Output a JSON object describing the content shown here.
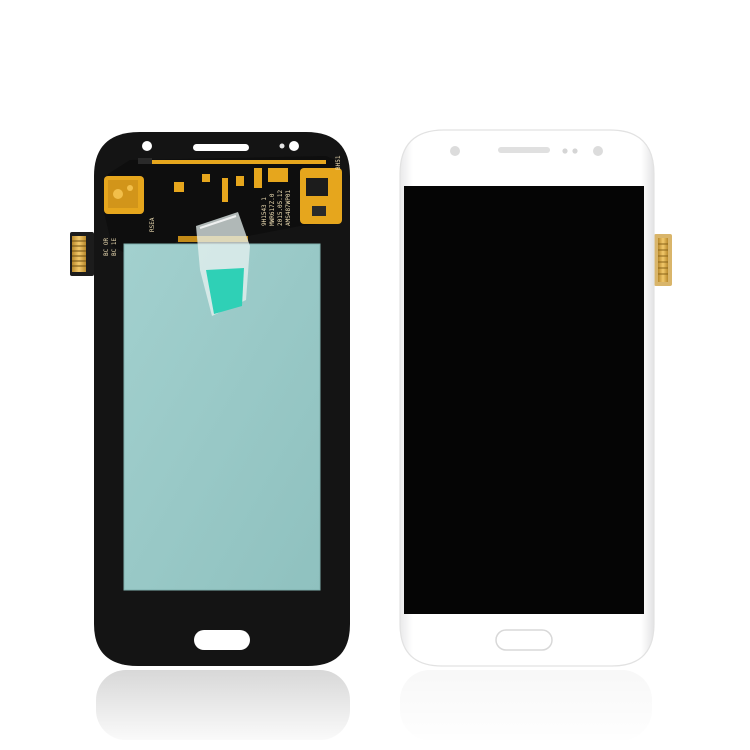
{
  "scene": {
    "background": "#ffffff",
    "subject": "lcd-digitizer-assembly"
  },
  "back_panel": {
    "frame_color": "#141414",
    "film_color": "#97c9c7",
    "flex_color": "#e6a61d",
    "sticker_color": "#2fd0b6",
    "print_lines": [
      "AMS487WP01",
      "2015.05.12",
      "MWR617Z.0",
      "9H1543 1",
      "RSEA",
      "BC OR",
      "BC 1E",
      "BH51"
    ]
  },
  "front_panel": {
    "frame_color": "#ffffff",
    "screen_color": "#050505"
  }
}
